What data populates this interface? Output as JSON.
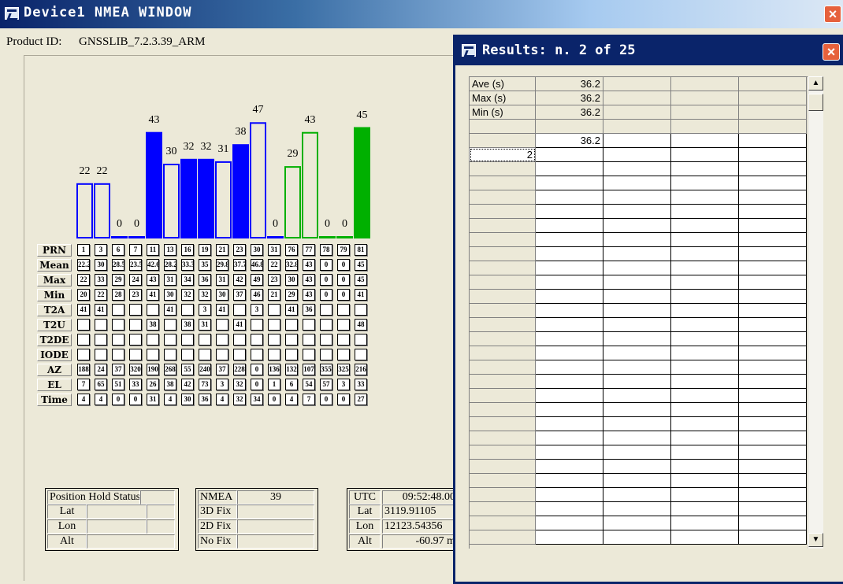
{
  "main_window": {
    "title": "Device1 NMEA WINDOW",
    "close": "×",
    "product_label": "Product ID:",
    "product_value": "GNSSLIB_7.2.3.39_ARM",
    "bar_values": [
      "22",
      "22",
      "0",
      "0",
      "43",
      "30",
      "32",
      "32",
      "31",
      "38",
      "47",
      "0",
      "29",
      "43",
      "0",
      "0",
      "45"
    ],
    "bar_styles": [
      "blue-outline",
      "blue-outline",
      "blue-outline",
      "blue-outline",
      "blue-filled",
      "blue-outline",
      "blue-filled",
      "blue-filled",
      "blue-outline",
      "blue-filled",
      "blue-outline",
      "blue-outline",
      "green-outline",
      "green-outline",
      "green-outline",
      "green-outline",
      "green-filled"
    ],
    "colors": {
      "gps": "#0000ff",
      "glonass": "#00b000"
    },
    "table": {
      "row_headers": [
        "PRN",
        "Mean",
        "Max",
        "Min",
        "T2A",
        "T2U",
        "T2DE",
        "IODE",
        "AZ",
        "EL",
        "Time"
      ],
      "rows": [
        [
          "1",
          "3",
          "6",
          "7",
          "11",
          "13",
          "16",
          "19",
          "21",
          "23",
          "30",
          "31",
          "76",
          "77",
          "78",
          "79",
          "81"
        ],
        [
          "22.2",
          "30",
          "28.5",
          "23.5",
          "42.6",
          "28.2",
          "33.3",
          "35",
          "29.8",
          "37.7",
          "46.8",
          "22",
          "32.8",
          "43",
          "0",
          "0",
          "45"
        ],
        [
          "22",
          "33",
          "29",
          "24",
          "43",
          "31",
          "34",
          "36",
          "31",
          "42",
          "49",
          "23",
          "30",
          "43",
          "0",
          "0",
          "45"
        ],
        [
          "20",
          "22",
          "28",
          "23",
          "41",
          "30",
          "32",
          "32",
          "30",
          "37",
          "46",
          "21",
          "29",
          "43",
          "0",
          "0",
          "41"
        ],
        [
          "41",
          "41",
          "",
          "",
          "",
          "41",
          "",
          "3",
          "41",
          "",
          "3",
          "",
          "41",
          "36",
          "",
          "",
          ""
        ],
        [
          "",
          "",
          "",
          "",
          "38",
          "",
          "38",
          "31",
          "",
          "41",
          "",
          "",
          "",
          "",
          "",
          "",
          "48"
        ],
        [
          "",
          "",
          "",
          "",
          "",
          "",
          "",
          "",
          "",
          "",
          "",
          "",
          "",
          "",
          "",
          "",
          ""
        ],
        [
          "",
          "",
          "",
          "",
          "",
          "",
          "",
          "",
          "",
          "",
          "",
          "",
          "",
          "",
          "",
          "",
          ""
        ],
        [
          "188",
          "24",
          "37",
          "320",
          "190",
          "268",
          "55",
          "240",
          "37",
          "228",
          "0",
          "136",
          "132",
          "107",
          "355",
          "325",
          "216"
        ],
        [
          "7",
          "65",
          "51",
          "33",
          "26",
          "38",
          "42",
          "73",
          "3",
          "32",
          "0",
          "1",
          "6",
          "54",
          "57",
          "3",
          "33"
        ],
        [
          "4",
          "4",
          "0",
          "0",
          "31",
          "4",
          "30",
          "36",
          "4",
          "32",
          "34",
          "0",
          "4",
          "7",
          "0",
          "0",
          "27"
        ]
      ]
    },
    "position_hold": {
      "title": "Position Hold Status",
      "lat_label": "Lat",
      "lon_label": "Lon",
      "alt_label": "Alt"
    },
    "fix_status": {
      "nmea_label": "NMEA",
      "nmea_value": "39",
      "fix3d_label": "3D Fix",
      "fix2d_label": "2D Fix",
      "nofix_label": "No Fix"
    },
    "position": {
      "utc_label": "UTC",
      "utc_value": "09:52:48.00",
      "lat_label": "Lat",
      "lat_value": "3119.91105",
      "lon_label": "Lon",
      "lon_value": "12123.54356",
      "alt_label": "Alt",
      "alt_value": "-60.97 m"
    }
  },
  "results_window": {
    "title": "Results: n. 2 of 25",
    "close": "×",
    "stat_labels": [
      "Ave (s)",
      "Max (s)",
      "Min (s)"
    ],
    "stat_values": [
      "36.2",
      "36.2",
      "36.2"
    ],
    "summary_value": "36.2",
    "selected_row_index": "2",
    "scroll_up": "▲",
    "scroll_down": "▼"
  }
}
